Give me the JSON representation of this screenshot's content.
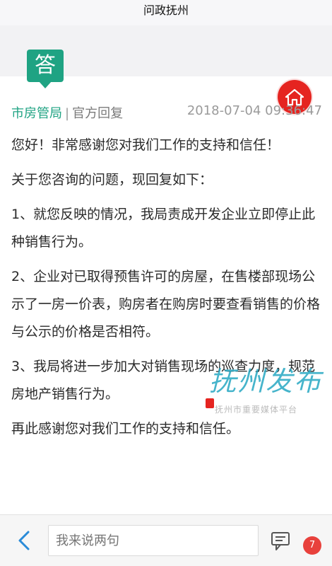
{
  "header": {
    "title": "问政抚州"
  },
  "badge": {
    "label": "答"
  },
  "reply": {
    "department": "市房管局",
    "separator": "|",
    "reply_type": "官方回复",
    "timestamp": "2018-07-04 09:36:47",
    "paragraphs": [
      "您好！非常感谢您对我们工作的支持和信任！",
      "关于您咨询的问题，现回复如下：",
      "1、就您反映的情况，我局责成开发企业立即停止此种销售行为。",
      "2、企业对已取得预售许可的房屋，在售楼部现场公示了一房一价表，购房者在购房时要查看销售的价格与公示的价格是否相符。",
      "3、我局将进一步加大对销售现场的巡查力度，规范房地产销售行为。",
      "再此感谢您对我们工作的支持和信任。"
    ]
  },
  "watermark": {
    "text": "抚州发布",
    "subtext": "抚州市重要媒体平台"
  },
  "footer": {
    "input_placeholder": "我来说两句",
    "comment_count": "7"
  },
  "colors": {
    "accent_green": "#1fa383",
    "home_red": "#e52420"
  },
  "icons": {
    "home": "home-icon",
    "back": "chevron-left-icon",
    "comment": "comment-icon"
  }
}
